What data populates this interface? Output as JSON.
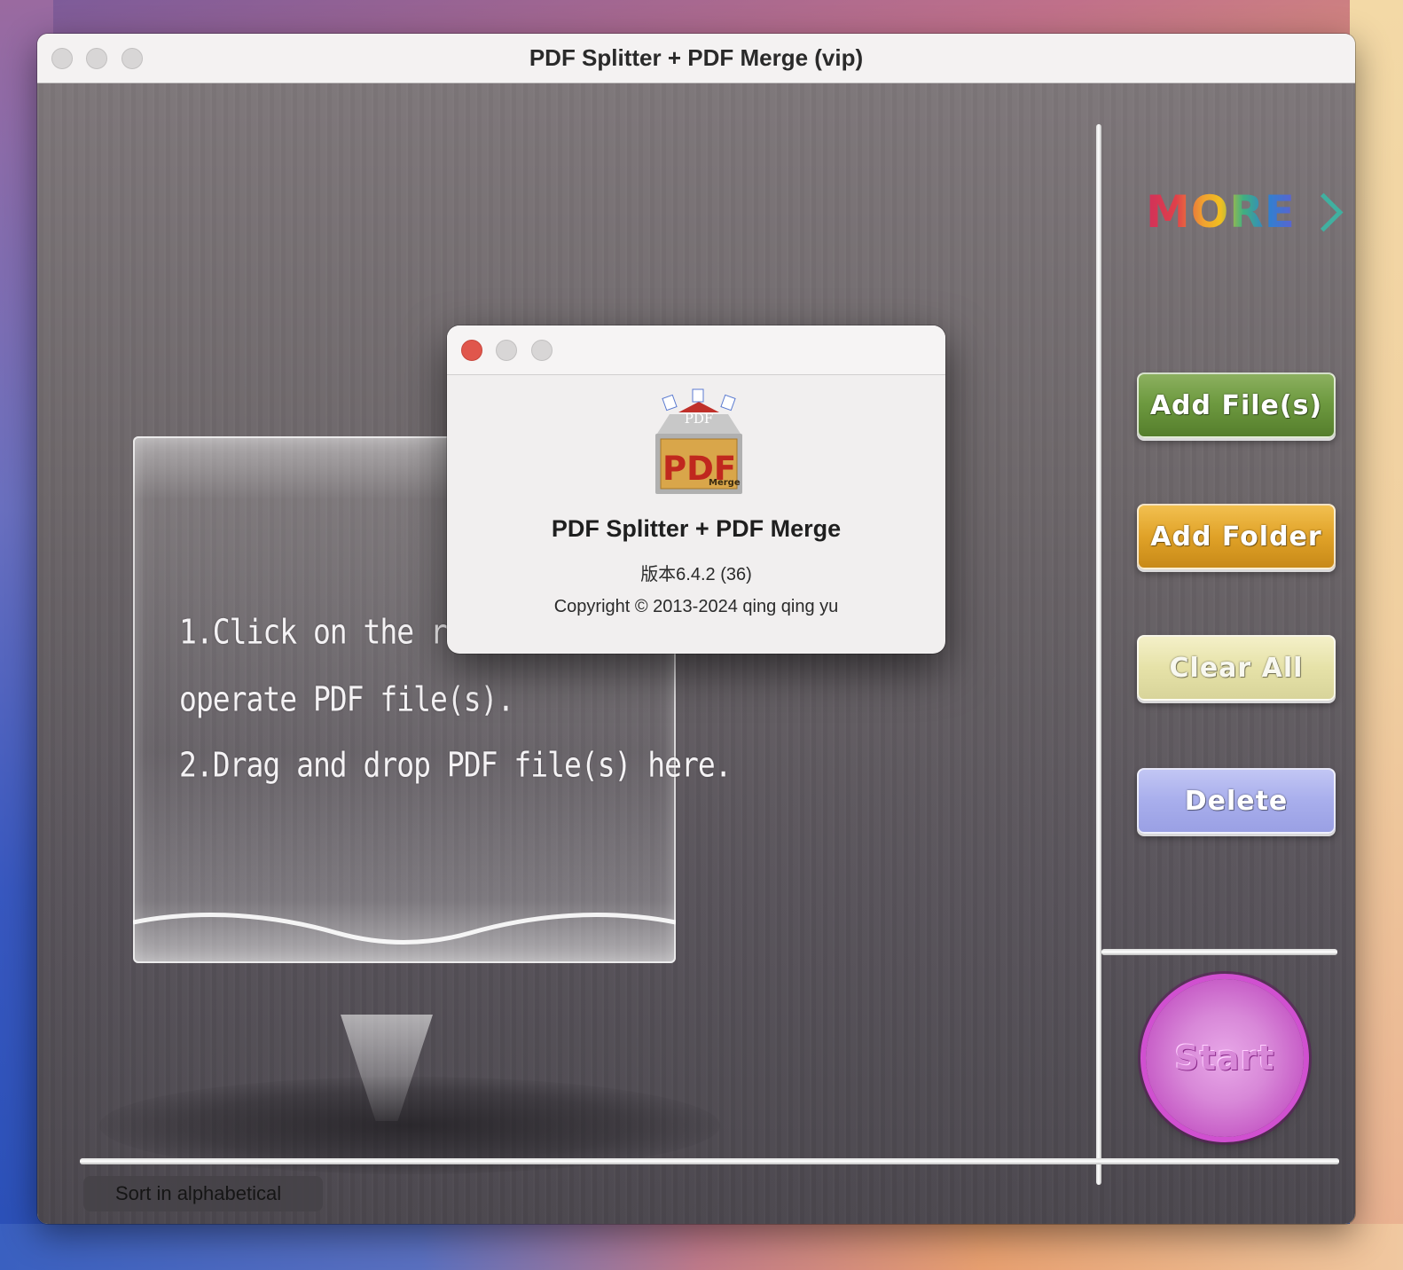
{
  "window": {
    "title": "PDF Splitter + PDF Merge (vip)"
  },
  "guide": {
    "line1": "1.Click on the righ",
    "line2": "operate PDF file(s).",
    "line3": "2.Drag and drop PDF file(s) here."
  },
  "sidebar": {
    "more_label": "MORE",
    "add_files": "Add File(s)",
    "add_folder": "Add Folder",
    "clear_all": "Clear All",
    "delete": "Delete",
    "start": "Start"
  },
  "footer": {
    "sort_label": "Sort in alphabetical"
  },
  "about": {
    "app_name": "PDF Splitter + PDF Merge",
    "version": "版本6.4.2 (36)",
    "copyright": "Copyright © 2013-2024 qing qing yu",
    "icon_top_text": "PDF",
    "icon_main_text": "PDF",
    "icon_sub_text": "Merge"
  },
  "colors": {
    "add_files": "#6e9a40",
    "add_folder": "#e0a228",
    "clear_all": "#e6e2a8",
    "delete": "#a8aeec",
    "start": "#d050d0",
    "close_button": "#e0564c"
  }
}
